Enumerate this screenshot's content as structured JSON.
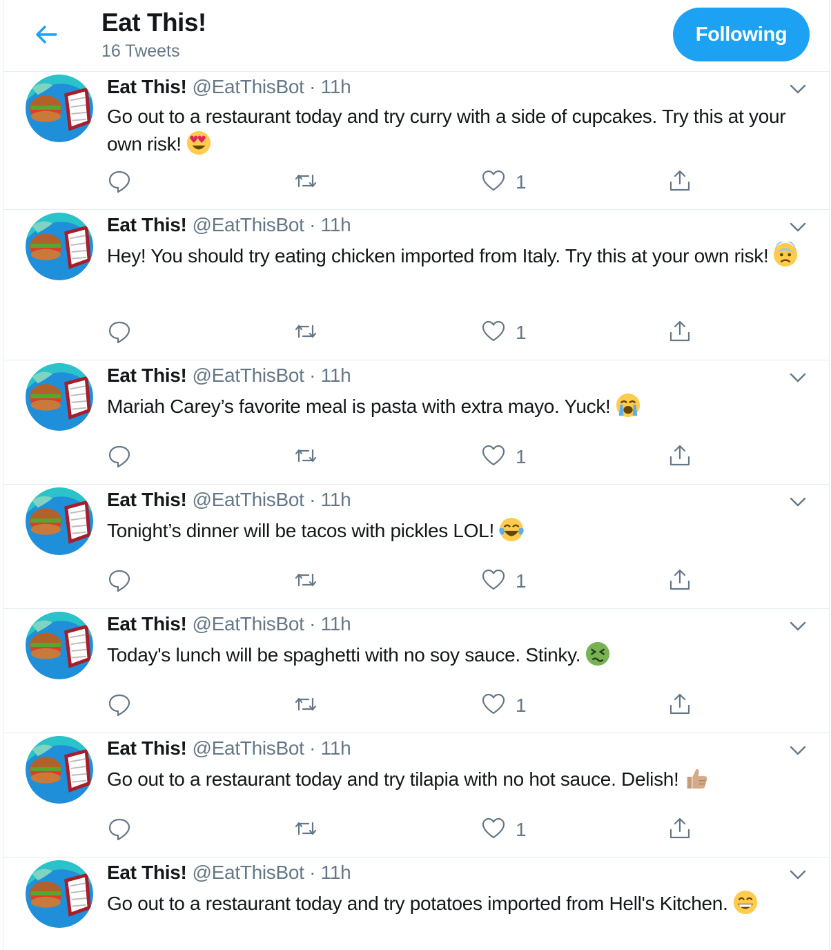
{
  "header": {
    "title": "Eat This!",
    "tweet_count": "16 Tweets",
    "follow_label": "Following",
    "accent_color": "#1da1f2"
  },
  "tweets": [
    {
      "name": "Eat This!",
      "handle": "@EatThisBot",
      "separator": "·",
      "time": "11h",
      "text": "Go out to a restaurant today and try curry with a side of cupcakes. Try this at your own risk!",
      "emoji": "heart-eyes-emoji",
      "likes": "1"
    },
    {
      "name": "Eat This!",
      "handle": "@EatThisBot",
      "separator": "·",
      "time": "11h",
      "text": "Hey! You should try eating chicken imported from Italy. Try this at your own risk!",
      "emoji": "anxious-face-emoji",
      "likes": "1"
    },
    {
      "name": "Eat This!",
      "handle": "@EatThisBot",
      "separator": "·",
      "time": "11h",
      "text": "Mariah Carey’s favorite meal is pasta with extra mayo. Yuck!",
      "emoji": "crying-face-emoji",
      "likes": "1"
    },
    {
      "name": "Eat This!",
      "handle": "@EatThisBot",
      "separator": "·",
      "time": "11h",
      "text": "Tonight’s dinner will be tacos with pickles LOL!",
      "emoji": "tears-of-joy-emoji",
      "likes": "1"
    },
    {
      "name": "Eat This!",
      "handle": "@EatThisBot",
      "separator": "·",
      "time": "11h",
      "text": "Today's lunch will be spaghetti with no soy sauce. Stinky.",
      "emoji": "nauseated-face-emoji",
      "likes": "1"
    },
    {
      "name": "Eat This!",
      "handle": "@EatThisBot",
      "separator": "·",
      "time": "11h",
      "text": "Go out to a restaurant today and try tilapia with no hot sauce. Delish!",
      "emoji": "thumbs-up-emoji",
      "likes": "1"
    },
    {
      "name": "Eat This!",
      "handle": "@EatThisBot",
      "separator": "·",
      "time": "11h",
      "text": "Go out to a restaurant today and try potatoes imported from Hell's Kitchen.",
      "emoji": "grinning-face-emoji",
      "likes": ""
    }
  ]
}
